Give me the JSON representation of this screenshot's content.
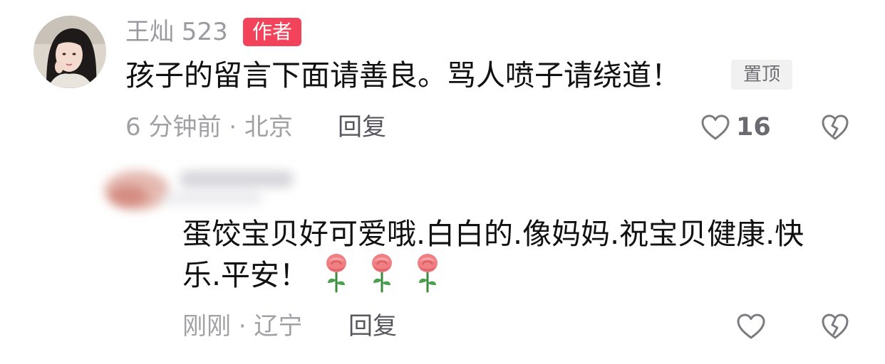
{
  "comment_1": {
    "username": "王灿 523",
    "author_badge": "作者",
    "text": "孩子的留言下面请善良。骂人喷子请绕道！",
    "pin_badge": "置顶",
    "meta": "6 分钟前 · 北京",
    "reply_label": "回复",
    "like_count": "16"
  },
  "comment_2": {
    "text_line_1": "蛋饺宝贝好可爱哦.白白的.像妈妈.祝宝贝健康.快",
    "text_line_2": "乐.平安！",
    "emoji": [
      "rose",
      "rose",
      "rose"
    ],
    "meta": "刚刚 · 辽宁",
    "reply_label": "回复"
  },
  "icons": {
    "like": "heart-outline-icon",
    "dislike": "broken-heart-icon"
  },
  "colors": {
    "author_badge": "#f2435a",
    "pin_badge_bg": "#f1f1f2",
    "muted_text": "#a0a0a5",
    "primary_text": "#111111"
  }
}
